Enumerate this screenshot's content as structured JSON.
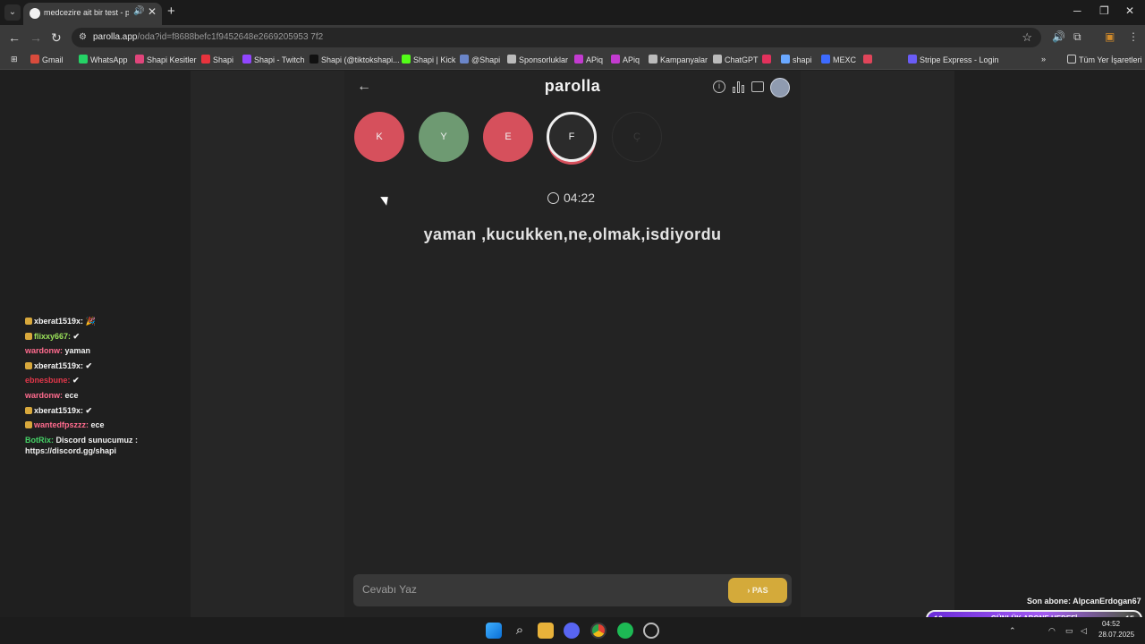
{
  "browser": {
    "tab_title": "medcezire ait bir test - parolla",
    "audio_glyph": "🔊",
    "close_glyph": "✕",
    "new_tab_glyph": "+",
    "url_host": "parolla.app",
    "url_path": "/oda?id=f8688befc1f9452648e2669205953 7f2",
    "bookmarks": [
      {
        "label": "Gmail",
        "color": "#d94b3c"
      },
      {
        "label": "WhatsApp",
        "color": "#25d366"
      },
      {
        "label": "Shapi Kesitler",
        "color": "#e0457b"
      },
      {
        "label": "Shapi",
        "color": "#e8333d"
      },
      {
        "label": "Shapi - Twitch",
        "color": "#9146ff"
      },
      {
        "label": "Shapi (@tiktokshapi...",
        "color": "#111111"
      },
      {
        "label": "Shapi | Kick",
        "color": "#53fc18"
      },
      {
        "label": "@Shapi",
        "color": "#6b86c9"
      },
      {
        "label": "Sponsorluklar",
        "color": "#bbbbbb"
      },
      {
        "label": "APiq",
        "color": "#c33bd0"
      },
      {
        "label": "APiq",
        "color": "#c33bd0"
      },
      {
        "label": "Kampanyalar",
        "color": "#bbbbbb"
      },
      {
        "label": "ChatGPT",
        "color": "#bbbbbb"
      },
      {
        "label": "",
        "color": "#e2315c"
      },
      {
        "label": "shapi",
        "color": "#6aa8ff"
      },
      {
        "label": "MEXC",
        "color": "#3d6bff"
      },
      {
        "label": "",
        "color": "#e0455a"
      },
      {
        "label": "Stripe Express - Login",
        "color": "#6a5cf6"
      }
    ],
    "all_bookmarks_label": "Tüm Yer İşaretleri"
  },
  "app": {
    "logo": "parolla",
    "back_glyph": "←",
    "info_glyph": "i",
    "letters": [
      {
        "char": "K",
        "state": "wrong"
      },
      {
        "char": "Y",
        "state": "correct"
      },
      {
        "char": "E",
        "state": "wrong"
      },
      {
        "char": "F",
        "state": "active"
      },
      {
        "char": "Ç",
        "state": "pending"
      }
    ],
    "timer": "04:22",
    "question": "yaman ,kucukken,ne,olmak,isdiyordu",
    "answer_placeholder": "Cevabı Yaz",
    "pas_label": "› PAS"
  },
  "chat": [
    {
      "user": "xberat1519x",
      "user_color": "#f5f5f5",
      "msg": " 🎉",
      "badge": true
    },
    {
      "user": "flixxy667",
      "user_color": "#9be35a",
      "msg": " ✔",
      "badge": true
    },
    {
      "user": "wardonw",
      "user_color": "#ff6b8e",
      "msg": " yaman",
      "badge": false
    },
    {
      "user": "xberat1519x",
      "user_color": "#f5f5f5",
      "msg": " ✔",
      "badge": true
    },
    {
      "user": "ebnesbune",
      "user_color": "#e3374a",
      "msg": " ✔",
      "badge": false
    },
    {
      "user": "wardonw",
      "user_color": "#ff6b8e",
      "msg": " ece",
      "badge": false
    },
    {
      "user": "xberat1519x",
      "user_color": "#f5f5f5",
      "msg": " ✔",
      "badge": true
    },
    {
      "user": "wantedfpszzz",
      "user_color": "#ff6b8e",
      "msg": " ece",
      "badge": true
    },
    {
      "user": "BotRix",
      "user_color": "#45d166",
      "msg": " Discord sunucumuz : https://discord.gg/shapi",
      "badge": false
    }
  ],
  "sub_goal": {
    "last_sub": "Son abone: AlpcanErdogan67",
    "current": "10",
    "label": "GÜNLÜK ABONE HEDEFİ",
    "target": "15"
  },
  "system": {
    "time": "04:52",
    "date": "28.07.2025"
  }
}
